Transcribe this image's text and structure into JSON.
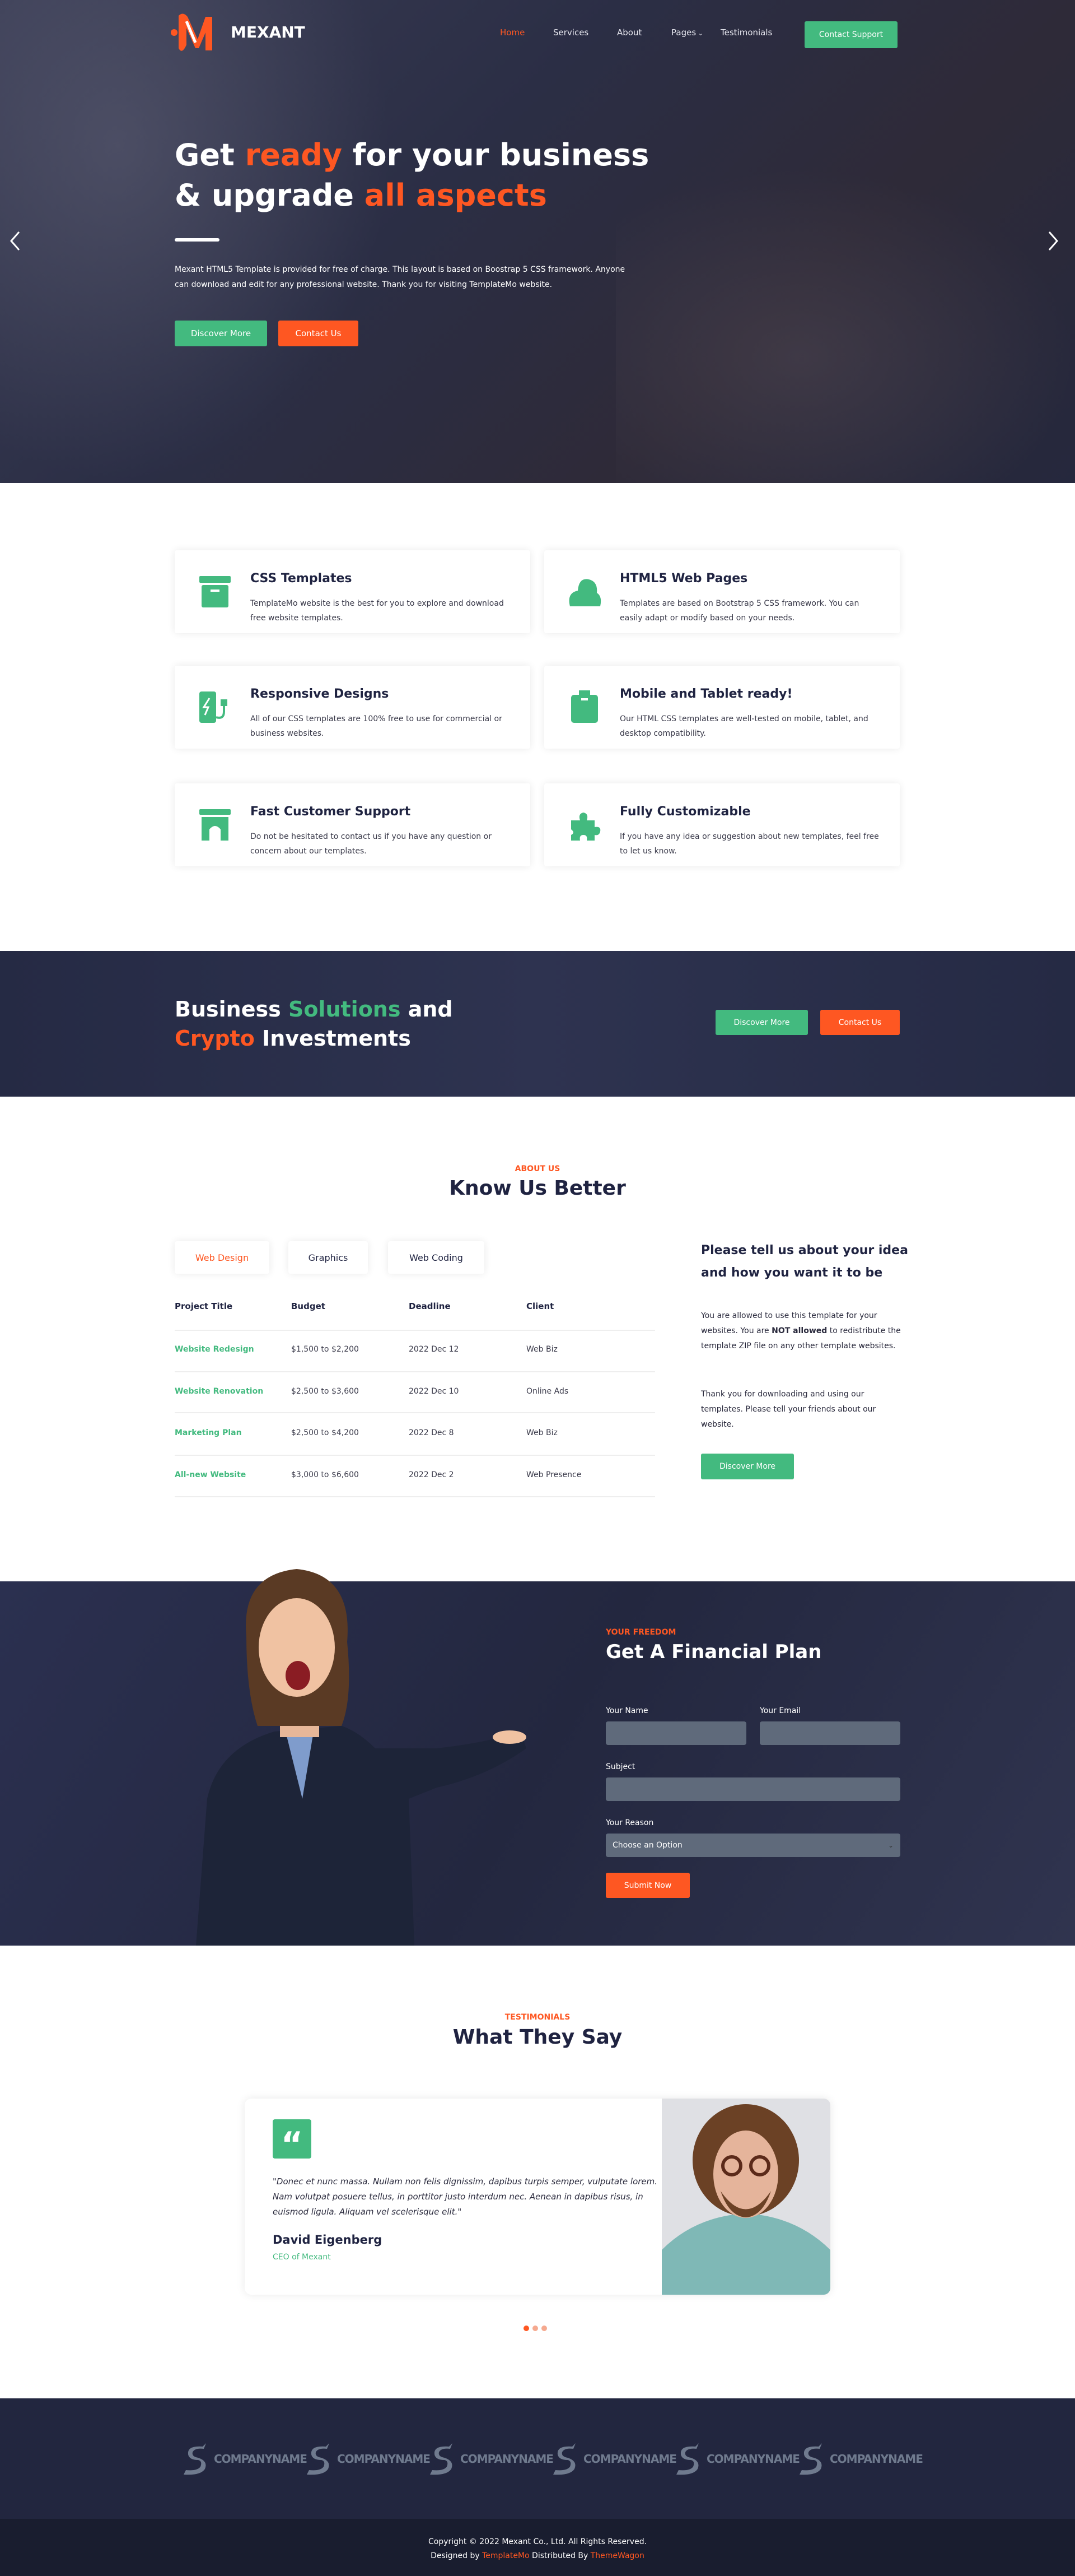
{
  "colors": {
    "accent": "#fe5722",
    "green": "#43ba7f",
    "dark": "#22263f",
    "footer": "#191d2f"
  },
  "header": {
    "brand": "MEXANT",
    "nav": [
      {
        "label": "Home",
        "active": true
      },
      {
        "label": "Services"
      },
      {
        "label": "About"
      },
      {
        "label": "Pages",
        "dropdown": true
      },
      {
        "label": "Testimonials"
      }
    ],
    "cta": "Contact Support"
  },
  "hero": {
    "line1_a": "Get ",
    "line1_hl": "ready",
    "line1_b": " for your business",
    "line2_a": "& upgrade ",
    "line2_hl": "all aspects",
    "text": "Mexant HTML5 Template is provided for free of charge. This layout is based on Boostrap 5 CSS framework. Anyone can download and edit for any professional website. Thank you for visiting TemplateMo website.",
    "btn_primary": "Discover More",
    "btn_secondary": "Contact Us",
    "prev_icon": "chevron-left-icon",
    "next_icon": "chevron-right-icon"
  },
  "services": [
    {
      "title": "CSS Templates",
      "text": "TemplateMo website is the best for you to explore and download free website templates.",
      "icon": "archive-icon"
    },
    {
      "title": "HTML5 Web Pages",
      "text": "Templates are based on Bootstrap 5 CSS framework. You can easily adapt or modify based on your needs.",
      "icon": "cloud-icon"
    },
    {
      "title": "Responsive Designs",
      "text": "All of our CSS templates are 100% free to use for commercial or business websites.",
      "icon": "charging-station-icon"
    },
    {
      "title": "Mobile and Tablet ready!",
      "text": "Our HTML CSS templates are well-tested on mobile, tablet, and desktop compatibility.",
      "icon": "suitcase-icon"
    },
    {
      "title": "Fast Customer Support",
      "text": "Do not be hesitated to contact us if you have any question or concern about our templates.",
      "icon": "archway-icon"
    },
    {
      "title": "Fully Customizable",
      "text": "If you have any idea or suggestion about new templates, feel free to let us know.",
      "icon": "puzzle-icon"
    }
  ],
  "banner": {
    "a": "Business ",
    "hl1": "Solutions",
    "b": " and",
    "hl2": "Crypto",
    "c": " Investments",
    "btn_primary": "Discover More",
    "btn_secondary": "Contact Us"
  },
  "about": {
    "label": "ABOUT US",
    "title": "Know Us Better",
    "tabs": [
      "Web Design",
      "Graphics",
      "Web Coding"
    ],
    "active_tab": "Web Design",
    "columns": [
      "Project Title",
      "Budget",
      "Deadline",
      "Client"
    ],
    "rows": [
      [
        "Website Redesign",
        "$1,500 to $2,200",
        "2022 Dec 12",
        "Web Biz"
      ],
      [
        "Website Renovation",
        "$2,500 to $3,600",
        "2022 Dec 10",
        "Online Ads"
      ],
      [
        "Marketing Plan",
        "$2,500 to $4,200",
        "2022 Dec 8",
        "Web Biz"
      ],
      [
        "All-new Website",
        "$3,000 to $6,600",
        "2022 Dec 2",
        "Web Presence"
      ]
    ],
    "side_title": "Please tell us about your idea and how you want it to be",
    "side_p1_a": "You are allowed to use this template for your websites. You are ",
    "side_p1_bold": "NOT allowed",
    "side_p1_b": " to redistribute the template ZIP file on any other template websites.",
    "side_p2": "Thank you for downloading and using our templates. Please tell your friends about our website.",
    "side_btn": "Discover More"
  },
  "plan": {
    "label": "YOUR FREEDOM",
    "title": "Get A Financial Plan",
    "name_label": "Your Name",
    "email_label": "Your Email",
    "subject_label": "Subject",
    "reason_label": "Your Reason",
    "reason_value": "Choose an Option",
    "submit": "Submit Now"
  },
  "testimonials": {
    "label": "TESTIMONIALS",
    "title": "What They Say",
    "quote": "\"Donec et nunc massa. Nullam non felis dignissim, dapibus turpis semper, vulputate lorem. Nam volutpat posuere tellus, in porttitor justo interdum nec. Aenean in dapibus risus, in euismod ligula. Aliquam vel scelerisque elit.\"",
    "name": "David Eigenberg",
    "role": "CEO of Mexant",
    "slides": 3,
    "active_slide": 1
  },
  "clients": [
    "COMPANYNAME",
    "COMPANYNAME",
    "COMPANYNAME",
    "COMPANYNAME",
    "COMPANYNAME",
    "COMPANYNAME"
  ],
  "footer": {
    "copyright": "Copyright © 2022 Mexant Co., Ltd. All Rights Reserved.",
    "designed": "Designed by ",
    "designer": "TemplateMo",
    "distributed": " Distributed By ",
    "distributor": "ThemeWagon"
  }
}
